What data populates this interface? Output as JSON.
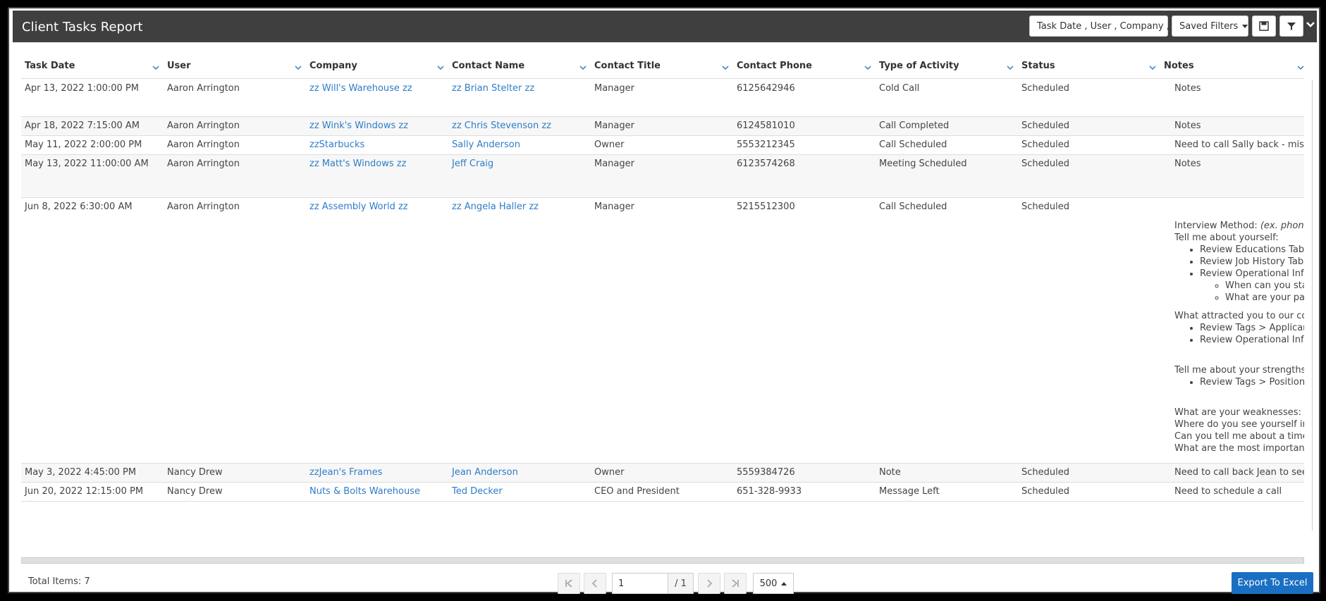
{
  "title": "Client Tasks Report",
  "toolbar": {
    "group_by": "Task Date , User , Company ,",
    "saved_filters": "Saved Filters"
  },
  "columns": [
    "Task Date",
    "User",
    "Company",
    "Contact Name",
    "Contact Title",
    "Contact Phone",
    "Type of Activity",
    "Status",
    "Notes"
  ],
  "rows": [
    {
      "date": "Apr 13, 2022 1:00:00 PM",
      "user": "Aaron Arrington",
      "company": "zz Will's Warehouse zz",
      "contact": "zz Brian Stelter zz",
      "title": "Manager",
      "phone": "6125642946",
      "activity": "Cold Call",
      "status": "Scheduled",
      "notes": "Notes"
    },
    {
      "date": "Apr 18, 2022 7:15:00 AM",
      "user": "Aaron Arrington",
      "company": "zz Wink's Windows zz",
      "contact": "zz Chris Stevenson zz",
      "title": "Manager",
      "phone": "6124581010",
      "activity": "Call Completed",
      "status": "Scheduled",
      "notes": "Notes"
    },
    {
      "date": "May 11, 2022 2:00:00 PM",
      "user": "Aaron Arrington",
      "company": "zzStarbucks",
      "contact": "Sally Anderson",
      "title": "Owner",
      "phone": "5553212345",
      "activity": "Call Scheduled",
      "status": "Scheduled",
      "notes": "Need to call Sally back - missed h"
    },
    {
      "date": "May 13, 2022 11:00:00 AM",
      "user": "Aaron Arrington",
      "company": "zz Matt's Windows zz",
      "contact": "Jeff Craig",
      "title": "Manager",
      "phone": "6123574268",
      "activity": "Meeting Scheduled",
      "status": "Scheduled",
      "notes": "Notes"
    },
    {
      "date": "Jun 8, 2022 6:30:00 AM",
      "user": "Aaron Arrington",
      "company": "zz Assembly World zz",
      "contact": "zz Angela Haller zz",
      "title": "Manager",
      "phone": "5215512300",
      "activity": "Call Scheduled",
      "status": "Scheduled",
      "notes": ""
    },
    {
      "date": "May 3, 2022 4:45:00 PM",
      "user": "Nancy Drew",
      "company": "zzJean's Frames",
      "contact": "Jean Anderson",
      "title": "Owner",
      "phone": "5559384726",
      "activity": "Note",
      "status": "Scheduled",
      "notes": "Need to call back Jean to see if sh"
    },
    {
      "date": "Jun 20, 2022 12:15:00 PM",
      "user": "Nancy Drew",
      "company": "Nuts & Bolts Warehouse",
      "contact": "Ted Decker",
      "title": "CEO and President",
      "phone": "651-328-9933",
      "activity": "Message Left",
      "status": "Scheduled",
      "notes": "Need to schedule a call"
    }
  ],
  "long_note": {
    "method_label": "Interview Method: ",
    "method_hint": "(ex. phone, in-p",
    "q1": "Tell me about yourself:",
    "q1_items": [
      "Review Educations Tab",
      "Review Job History Tab",
      "Review Operational Info Wid"
    ],
    "q1_sub": [
      "When can you start?",
      "What are your pay re"
    ],
    "q2": "What attracted you to our compa",
    "q2_items": [
      "Review Tags > Applicant Sou",
      "Review Operational Info Wid"
    ],
    "q3": "Tell me about your strengths:",
    "q3_items": [
      "Review Tags > Position Cate"
    ],
    "q4": "What are your weaknesses:",
    "q5": "Where do you see yourself in five y",
    "q6": "Can you tell me about a time whe",
    "q7": "What are the most important thin"
  },
  "footer": {
    "total_items": "Total Items: 7",
    "page_value": "1",
    "page_total": "/ 1",
    "page_size": "500",
    "export": "Export To Excel"
  }
}
